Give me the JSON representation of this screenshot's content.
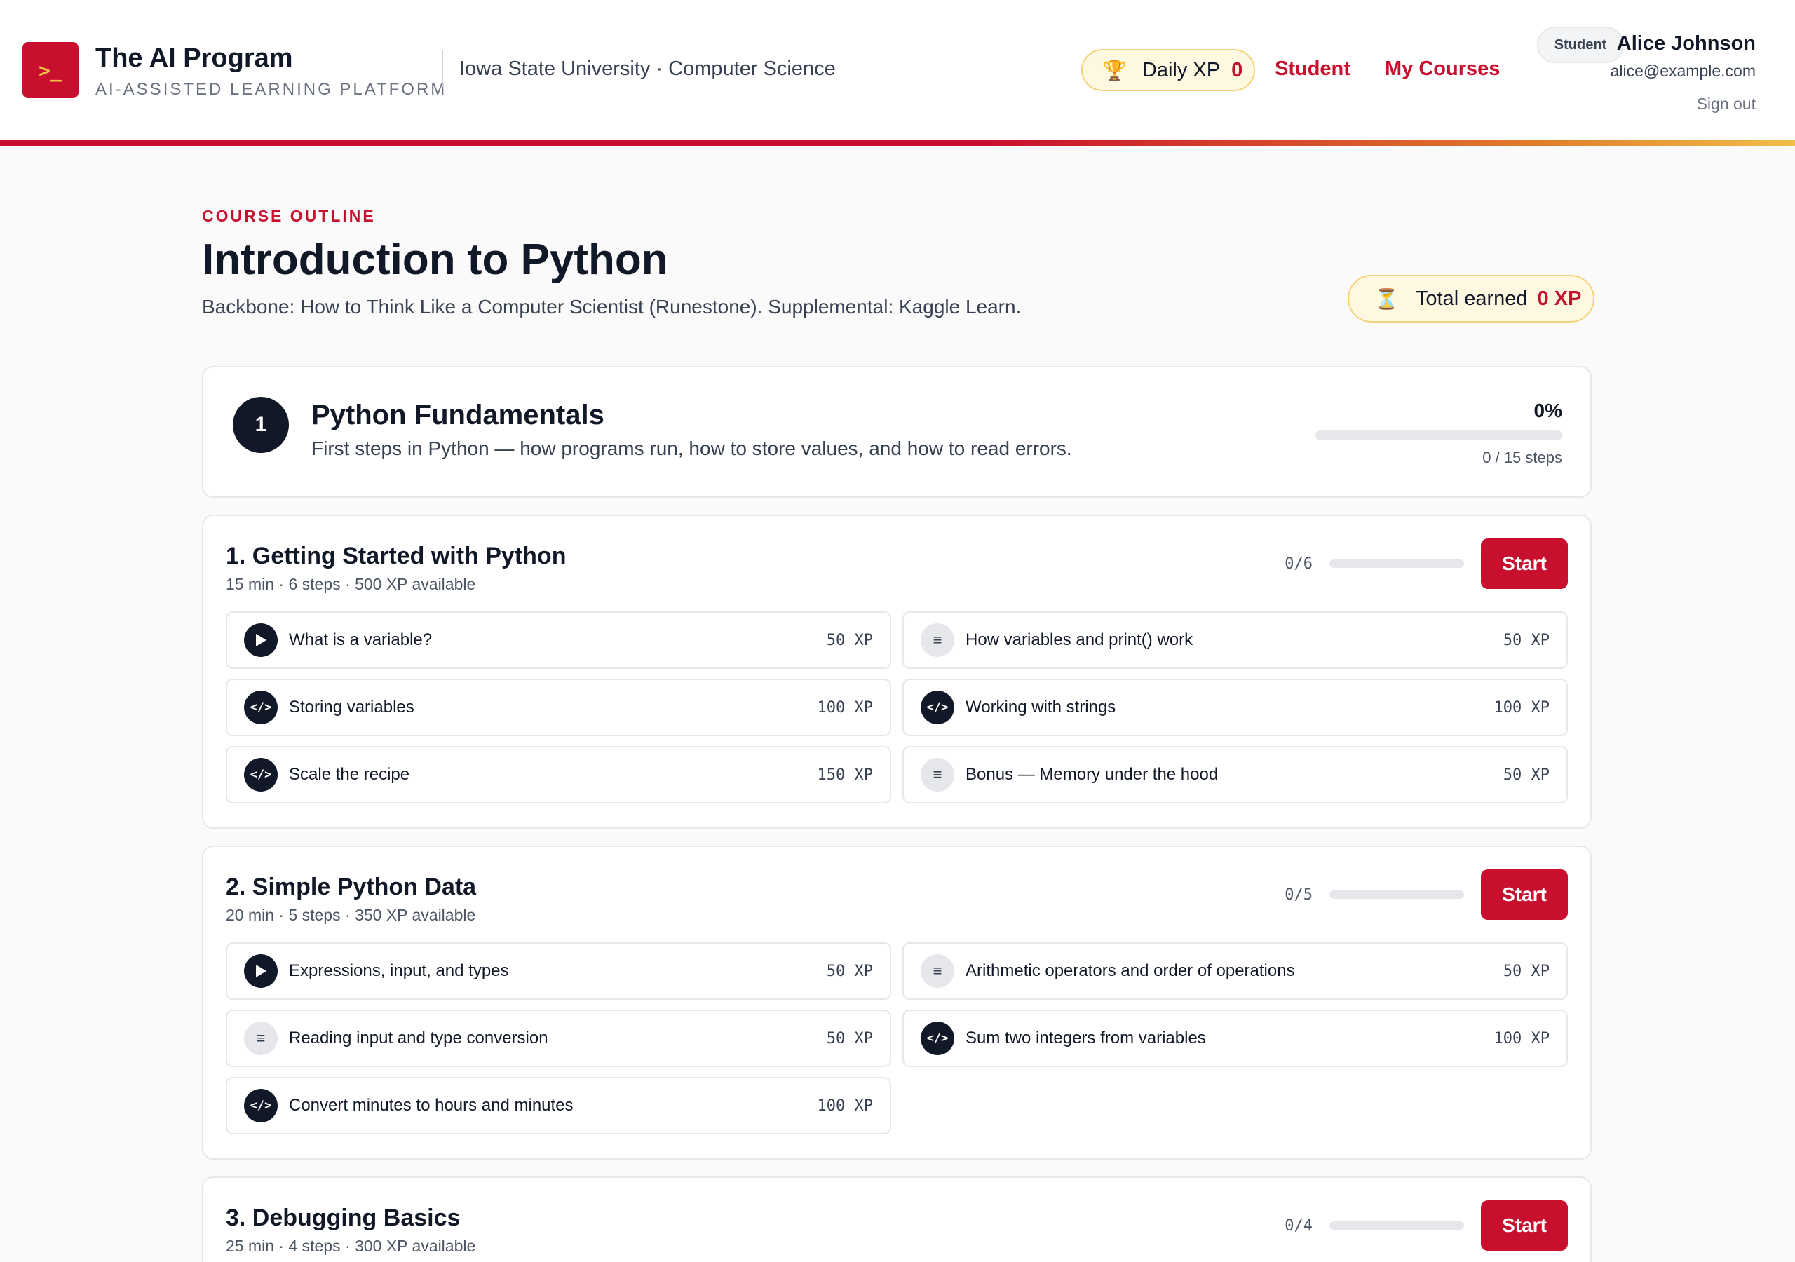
{
  "brand": {
    "logo_glyph": ">_",
    "title": "The AI Program",
    "subtitle": "AI-ASSISTED LEARNING PLATFORM",
    "org": "Iowa State University · Computer Science"
  },
  "header": {
    "daily_xp_label": "Daily XP",
    "daily_xp_value": "0",
    "nav": [
      "Student",
      "My Courses"
    ],
    "role": "Student",
    "user_name": "Alice Johnson",
    "user_email": "alice@example.com",
    "sign_out": "Sign out"
  },
  "page": {
    "eyebrow": "COURSE OUTLINE",
    "title": "Introduction to Python",
    "description": "Backbone: How to Think Like a Computer Scientist (Runestone). Supplemental: Kaggle Learn.",
    "total_label": "Total earned",
    "total_value": "0 XP"
  },
  "module": {
    "number": "1",
    "title": "Python Fundamentals",
    "description": "First steps in Python — how programs run, how to store values, and how to read errors.",
    "percent_label": "0%",
    "progress": 0,
    "steps_label": "0 / 15 steps"
  },
  "lessons": [
    {
      "title": "1. Getting Started with Python",
      "meta": "15 min · 6 steps · 500 XP available",
      "count": "0/6",
      "progress": 0,
      "button": "Start",
      "steps": [
        {
          "icon": "play-icon",
          "type": "video",
          "label": "What is a variable?",
          "xp": "50 XP"
        },
        {
          "icon": "reading-icon",
          "type": "reading",
          "label": "How variables and print() work",
          "xp": "50 XP"
        },
        {
          "icon": "code-icon",
          "type": "code",
          "label": "Storing variables",
          "xp": "100 XP"
        },
        {
          "icon": "code-icon",
          "type": "code",
          "label": "Working with strings",
          "xp": "100 XP"
        },
        {
          "icon": "code-icon",
          "type": "code",
          "label": "Scale the recipe",
          "xp": "150 XP"
        },
        {
          "icon": "reading-icon",
          "type": "reading",
          "label": "Bonus — Memory under the hood",
          "xp": "50 XP"
        }
      ]
    },
    {
      "title": "2. Simple Python Data",
      "meta": "20 min · 5 steps · 350 XP available",
      "count": "0/5",
      "progress": 0,
      "button": "Start",
      "steps": [
        {
          "icon": "play-icon",
          "type": "video",
          "label": "Expressions, input, and types",
          "xp": "50 XP"
        },
        {
          "icon": "reading-icon",
          "type": "reading",
          "label": "Arithmetic operators and order of operations",
          "xp": "50 XP"
        },
        {
          "icon": "reading-icon",
          "type": "reading",
          "label": "Reading input and type conversion",
          "xp": "50 XP"
        },
        {
          "icon": "code-icon",
          "type": "code",
          "label": "Sum two integers from variables",
          "xp": "100 XP"
        },
        {
          "icon": "code-icon",
          "type": "code",
          "label": "Convert minutes to hours and minutes",
          "xp": "100 XP"
        }
      ]
    },
    {
      "title": "3. Debugging Basics",
      "meta": "25 min · 4 steps · 300 XP available",
      "count": "0/4",
      "progress": 0,
      "button": "Start",
      "steps": []
    }
  ]
}
